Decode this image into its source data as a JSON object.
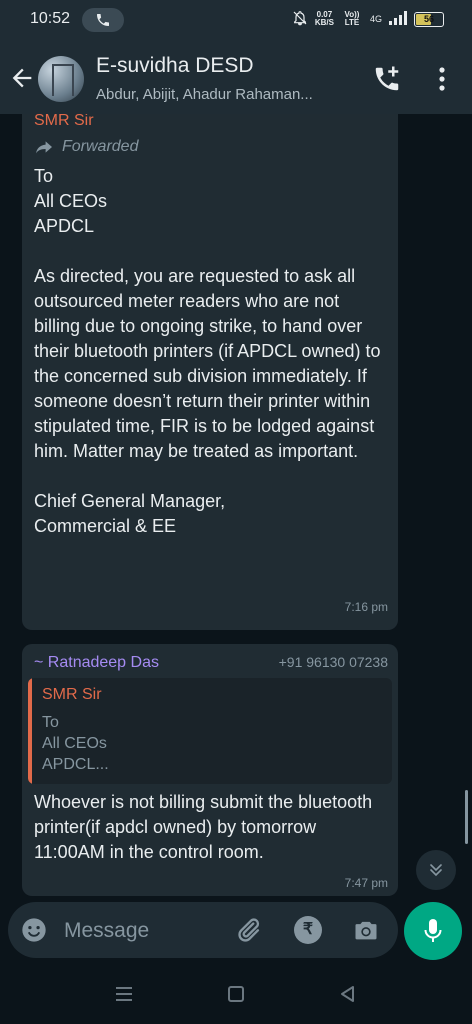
{
  "status_bar": {
    "time": "10:52",
    "net_speed_value": "0.07",
    "net_speed_unit": "KB/S",
    "volte": "Vo)) LTE",
    "network": "4G",
    "battery": "56"
  },
  "header": {
    "title": "E-suvidha DESD",
    "members": "Abdur, Abijit, Ahadur Rahaman..."
  },
  "messages": [
    {
      "sender": "SMR Sir",
      "forwarded_label": "Forwarded",
      "text": "To\nAll CEOs\nAPDCL\n\nAs directed, you are requested to ask all outsourced meter readers who are not billing due to ongoing strike, to hand over their bluetooth printers (if APDCL owned) to the concerned sub division immediately. If someone doesn’t return their printer within stipulated time, FIR is to be lodged against him. Matter may be treated as important.\n\nChief General Manager,\nCommercial & EE",
      "time": "7:16 pm"
    },
    {
      "sender": "~ Ratnadeep Das",
      "phone": "+91 96130 07238",
      "quote": {
        "sender": "SMR Sir",
        "text": "To\nAll CEOs\nAPDCL..."
      },
      "text": "Whoever is not billing submit the bluetooth printer(if apdcl owned) by tomorrow 11:00AM in the control room.",
      "time": "7:47 pm"
    }
  ],
  "composer": {
    "placeholder": "Message"
  },
  "colors": {
    "background": "#0b141a",
    "bubble": "#202c33",
    "header": "#1f2c34",
    "accent_green": "#00a884",
    "sender_orange": "#e26a4a",
    "sender_purple": "#a58bf2"
  },
  "icons": [
    "phone-icon",
    "back-arrow-icon",
    "add-call-icon",
    "more-vert-icon",
    "forward-arrow-icon",
    "chevrons-down-icon",
    "emoji-icon",
    "paperclip-icon",
    "rupee-icon",
    "camera-icon",
    "mic-icon",
    "menu-lines-icon",
    "square-icon",
    "triangle-back-icon"
  ]
}
